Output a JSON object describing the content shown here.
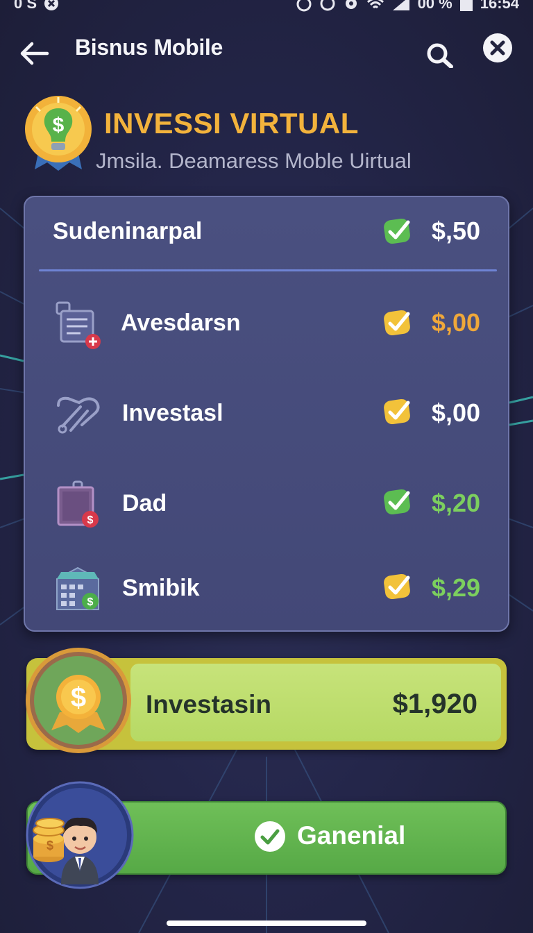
{
  "status_bar": {
    "left_text": "0 S",
    "battery": "00 %",
    "time": "16:54"
  },
  "app_bar": {
    "title": "Bisnus Mobile",
    "back_icon": "arrow-left-icon",
    "search_icon": "search-icon",
    "close_icon": "close-icon"
  },
  "header": {
    "title": "INVESSI VIRTUAL",
    "subtitle": "Jmsila. Deamaress Moble Uirtual",
    "badge_icon": "lightbulb-dollar-icon"
  },
  "card": {
    "summary": {
      "label": "Sudeninarpal",
      "value": "$,50",
      "check_color": "#5cbd52"
    },
    "items": [
      {
        "label": "Avesdarsn",
        "value": "$,00",
        "value_color": "#f0a83a",
        "check_color": "#f2c23a",
        "icon": "document-add-icon"
      },
      {
        "label": "Investasl",
        "value": "$,00",
        "value_color": "#ffffff",
        "check_color": "#f2c23a",
        "icon": "handshake-icon"
      },
      {
        "label": "Dad",
        "value": "$,20",
        "value_color": "#7ccf5e",
        "check_color": "#5cbd52",
        "icon": "bag-dollar-icon"
      },
      {
        "label": "Smibik",
        "value": "$,29",
        "value_color": "#7ccf5e",
        "check_color": "#f2c23a",
        "icon": "calendar-dollar-icon"
      }
    ]
  },
  "total": {
    "label": "Investasin",
    "value": "$1,920",
    "icon": "dollar-coin-icon"
  },
  "action": {
    "label": "Ganenial",
    "icon": "check-circle-icon"
  },
  "avatar": {
    "icon": "businessman-coins-avatar"
  },
  "colors": {
    "accent_gold": "#f3b33c",
    "card_bg": "#4a5080",
    "total_green": "#c7e37a",
    "action_green": "#62b44f"
  }
}
